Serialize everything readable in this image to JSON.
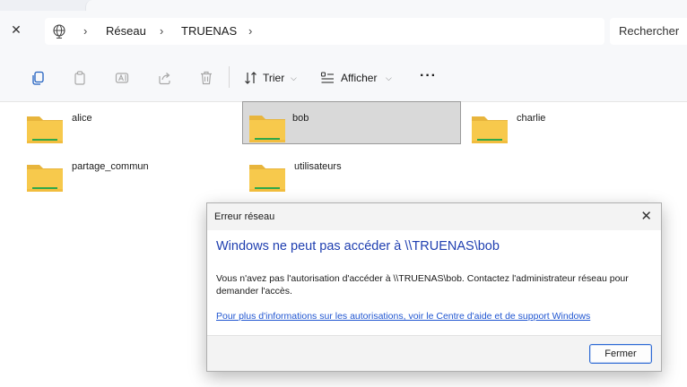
{
  "addressbar": {
    "crumbs": [
      "Réseau",
      "TRUENAS"
    ],
    "search_placeholder": "Rechercher"
  },
  "toolbar": {
    "sort_label": "Trier",
    "view_label": "Afficher",
    "more_label": "···",
    "icons": [
      "new-icon",
      "copy-icon",
      "rename-icon",
      "share-icon",
      "delete-icon",
      "sort-icon",
      "view-icon"
    ]
  },
  "folders": [
    {
      "name": "alice",
      "selected": false
    },
    {
      "name": "bob",
      "selected": true
    },
    {
      "name": "charlie",
      "selected": false
    },
    {
      "name": "partage_commun",
      "selected": false
    },
    {
      "name": "utilisateurs",
      "selected": false
    }
  ],
  "dialog": {
    "title": "Erreur réseau",
    "heading": "Windows ne peut pas accéder à \\\\TRUENAS\\bob",
    "message": "Vous n'avez pas l'autorisation d'accéder à \\\\TRUENAS\\bob. Contactez l'administrateur réseau pour demander l'accès.",
    "link": "Pour plus d'informations sur les autorisations, voir le Centre d'aide et de support Windows",
    "close_button": "Fermer"
  },
  "colors": {
    "heading": "#1f3fb0",
    "link": "#1f55d1",
    "folder": "#f7c94c",
    "folder_stripe": "#2fa84a",
    "selection": "#d9d9d9"
  }
}
